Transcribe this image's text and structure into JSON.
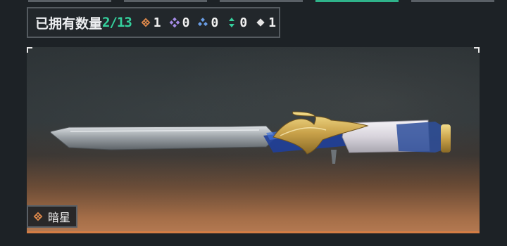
{
  "ownership": {
    "label": "已拥有数量",
    "count": "2/13",
    "rarities": [
      {
        "icon": "orange-diamond-icon",
        "color": "#e08a4c",
        "count": "1"
      },
      {
        "icon": "purple-diamond-icon",
        "color": "#a58be6",
        "count": "0"
      },
      {
        "icon": "blue-diamond-icon",
        "color": "#6a9ee6",
        "count": "0"
      },
      {
        "icon": "green-chevron-icon",
        "color": "#35d09d",
        "count": "0"
      },
      {
        "icon": "white-diamond-icon",
        "color": "#e6e6e6",
        "count": "1"
      }
    ]
  },
  "item": {
    "name": "暗星",
    "rarity_icon": "orange-diamond-icon",
    "rarity_color": "#e08a4c"
  },
  "colors": {
    "accent_green": "#35d09d",
    "rarity_orange": "#e08a4c"
  }
}
